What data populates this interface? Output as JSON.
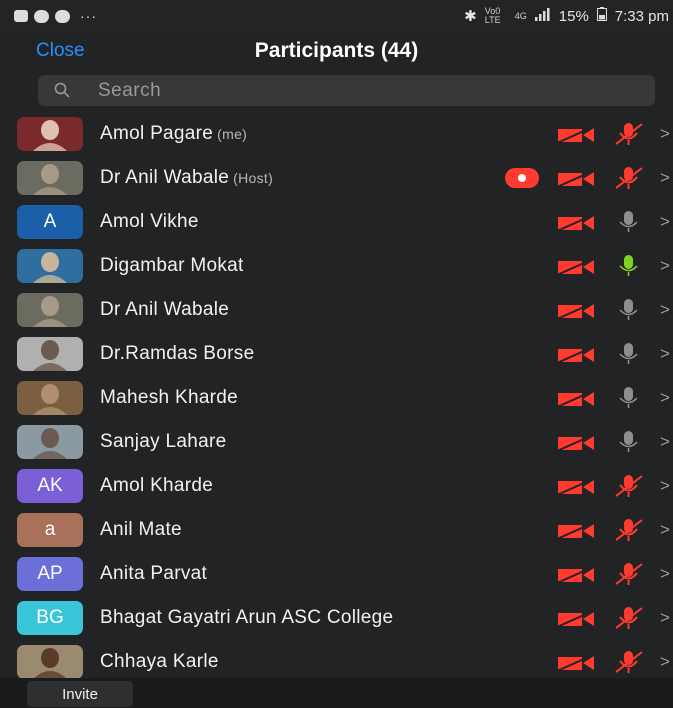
{
  "status_bar": {
    "dots": "···",
    "net_a": "Vo0 LTE",
    "net_b": "4G",
    "battery": "15%",
    "time": "7:33 pm",
    "icons": [
      "lock-icon",
      "call-icon",
      "call-icon",
      "bluetooth-icon",
      "signal-icon",
      "battery-icon"
    ]
  },
  "header": {
    "close_label": "Close",
    "title": "Participants (44)"
  },
  "search": {
    "placeholder": "Search"
  },
  "colors": {
    "accent": "#2d8cff",
    "muted_red": "#ff3b30",
    "mic_live": "#7ed321",
    "mic_idle": "#8e8e8e"
  },
  "participants": [
    {
      "name": "Amol Pagare",
      "tag": "(me)",
      "avatar": "photo",
      "mic": "muted",
      "recording": false
    },
    {
      "name": "Dr Anil Wabale",
      "tag": "(Host)",
      "avatar": "photo",
      "mic": "muted",
      "recording": true
    },
    {
      "name": "Amol Vikhe",
      "tag": "",
      "avatar": "A",
      "avatar_color": "#1a5fa8",
      "mic": "idle",
      "recording": false
    },
    {
      "name": "Digambar Mokat",
      "tag": "",
      "avatar": "photo",
      "mic": "live",
      "recording": false
    },
    {
      "name": "Dr Anil Wabale",
      "tag": "",
      "avatar": "photo",
      "mic": "idle",
      "recording": false
    },
    {
      "name": "Dr.Ramdas Borse",
      "tag": "",
      "avatar": "photo",
      "mic": "idle",
      "recording": false
    },
    {
      "name": "Mahesh Kharde",
      "tag": "",
      "avatar": "photo",
      "mic": "idle",
      "recording": false
    },
    {
      "name": "Sanjay Lahare",
      "tag": "",
      "avatar": "photo",
      "mic": "idle",
      "recording": false
    },
    {
      "name": "Amol Kharde",
      "tag": "",
      "avatar": "AK",
      "avatar_color": "#7a5fd6",
      "mic": "muted",
      "recording": false
    },
    {
      "name": "Anil Mate",
      "tag": "",
      "avatar": "a",
      "avatar_color": "#a9715a",
      "mic": "muted",
      "recording": false
    },
    {
      "name": "Anita Parvat",
      "tag": "",
      "avatar": "AP",
      "avatar_color": "#6c6fd8",
      "mic": "muted",
      "recording": false
    },
    {
      "name": "Bhagat Gayatri Arun ASC College",
      "tag": "",
      "avatar": "BG",
      "avatar_color": "#38c6d8",
      "mic": "muted",
      "recording": false
    },
    {
      "name": "Chhaya Karle",
      "tag": "",
      "avatar": "photo",
      "mic": "muted",
      "recording": false
    }
  ],
  "footer": {
    "invite_label": "Invite"
  }
}
